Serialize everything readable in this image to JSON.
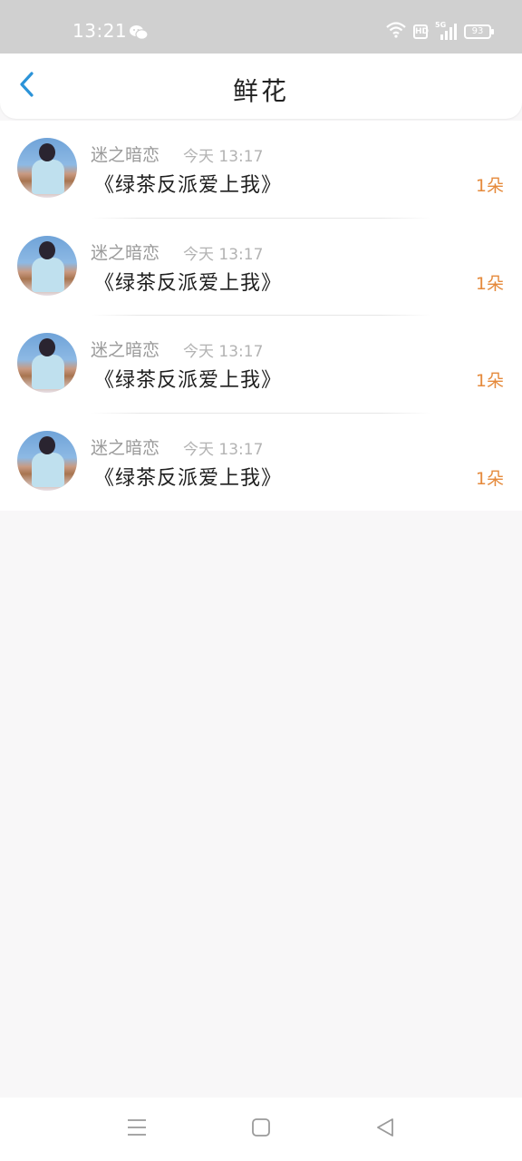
{
  "status_bar": {
    "time": "13:21",
    "network": "5G",
    "hd": "HD",
    "battery": "93",
    "icons": [
      "wechat-icon",
      "wifi-icon",
      "signal-icon",
      "battery-icon"
    ]
  },
  "header": {
    "title": "鲜花",
    "back_icon": "chevron-left-icon"
  },
  "colors": {
    "accent": "#2b93d8",
    "count": "#e58a3c",
    "sender": "#9a9a9a",
    "time": "#b3b3b3"
  },
  "gifts": [
    {
      "sender": "迷之暗恋",
      "time": "今天 13:17",
      "book": "《绿茶反派爱上我》",
      "count": "1朵"
    },
    {
      "sender": "迷之暗恋",
      "time": "今天 13:17",
      "book": "《绿茶反派爱上我》",
      "count": "1朵"
    },
    {
      "sender": "迷之暗恋",
      "time": "今天 13:17",
      "book": "《绿茶反派爱上我》",
      "count": "1朵"
    },
    {
      "sender": "迷之暗恋",
      "time": "今天 13:17",
      "book": "《绿茶反派爱上我》",
      "count": "1朵"
    }
  ],
  "nav_bar": {
    "icons": [
      "menu-icon",
      "home-icon",
      "back-icon"
    ]
  }
}
